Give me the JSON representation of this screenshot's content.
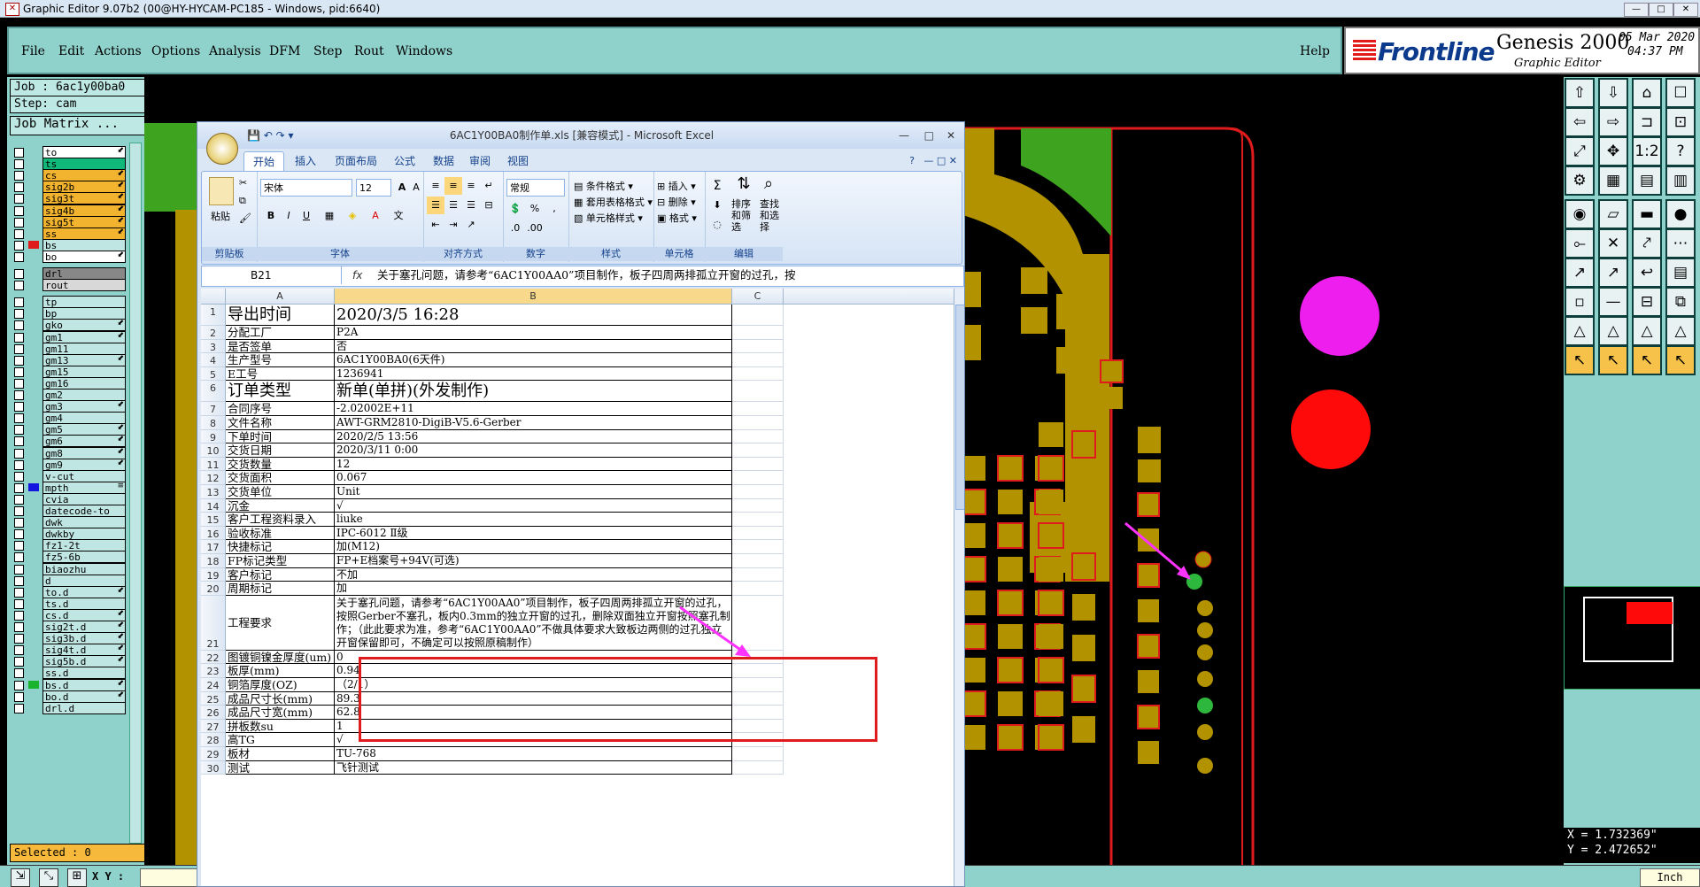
{
  "window": {
    "title": "Graphic Editor 9.07b2 (00@HY-HYCAM-PC185 - Windows, pid:6640)",
    "buttons": [
      "—",
      "□",
      "✕"
    ]
  },
  "menu": {
    "items": [
      "File",
      "Edit",
      "Actions",
      "Options",
      "Analysis",
      "DFM",
      "Step",
      "Rout",
      "Windows"
    ],
    "help": "Help"
  },
  "brand": {
    "frontline": "Frontline",
    "genesis": "Genesis 2000",
    "subtitle": "Graphic Editor",
    "date_line1": "05 Mar 2020",
    "date_line2": "04:37 PM"
  },
  "job": {
    "job": "Job : 6ac1y00ba0",
    "step": "Step: cam",
    "matrix": "Job Matrix ..."
  },
  "layers": [
    {
      "name": "to",
      "dir": "⬋",
      "color": ""
    },
    {
      "name": "ts",
      "dir": "",
      "color": "#10b87a"
    },
    {
      "name": "cs",
      "dir": "⬋",
      "color": "#f2b32e"
    },
    {
      "name": "sig2b",
      "dir": "⬋",
      "color": "#f2b32e"
    },
    {
      "name": "sig3t",
      "dir": "⬋",
      "color": "#f2b32e"
    },
    {
      "name": "sig4b",
      "dir": "⬋",
      "color": "#f2b32e"
    },
    {
      "name": "sig5t",
      "dir": "⬋",
      "color": "#f2b32e"
    },
    {
      "name": "ss",
      "dir": "⬋",
      "color": "#f2b32e"
    },
    {
      "name": "bs",
      "dir": "",
      "color": "#e01b1b"
    },
    {
      "name": "bo",
      "dir": "⬋",
      "color": ""
    },
    {
      "name": "drl",
      "dir": "",
      "color": "#888"
    },
    {
      "name": "rout",
      "dir": "",
      "color": "#d8d8d8"
    },
    {
      "name": "tp",
      "dir": "",
      "color": "#bfe6e2"
    },
    {
      "name": "bp",
      "dir": "",
      "color": "#bfe6e2"
    },
    {
      "name": "gko",
      "dir": "⬋",
      "color": "#bfe6e2"
    },
    {
      "name": "gm1",
      "dir": "⬋",
      "color": "#bfe6e2"
    },
    {
      "name": "gm11",
      "dir": "",
      "color": "#bfe6e2"
    },
    {
      "name": "gm13",
      "dir": "⬋",
      "color": "#bfe6e2"
    },
    {
      "name": "gm15",
      "dir": "",
      "color": "#bfe6e2"
    },
    {
      "name": "gm16",
      "dir": "",
      "color": "#bfe6e2"
    },
    {
      "name": "gm2",
      "dir": "",
      "color": "#bfe6e2"
    },
    {
      "name": "gm3",
      "dir": "⬋",
      "color": "#bfe6e2"
    },
    {
      "name": "gm4",
      "dir": "",
      "color": "#bfe6e2"
    },
    {
      "name": "gm5",
      "dir": "⬋",
      "color": "#bfe6e2"
    },
    {
      "name": "gm6",
      "dir": "⬋",
      "color": "#bfe6e2"
    },
    {
      "name": "gm8",
      "dir": "⬋",
      "color": "#bfe6e2"
    },
    {
      "name": "gm9",
      "dir": "⬋",
      "color": "#bfe6e2"
    },
    {
      "name": "v-cut",
      "dir": "",
      "color": "#bfe6e2"
    },
    {
      "name": "mpth",
      "dir": "≡",
      "color": "#1515e0"
    },
    {
      "name": "cvia",
      "dir": "",
      "color": "#bfe6e2"
    },
    {
      "name": "datecode-to",
      "dir": "",
      "color": "#bfe6e2"
    },
    {
      "name": "dwk",
      "dir": "",
      "color": "#bfe6e2"
    },
    {
      "name": "dwkby",
      "dir": "",
      "color": "#bfe6e2"
    },
    {
      "name": "fz1-2t",
      "dir": "",
      "color": "#bfe6e2"
    },
    {
      "name": "fz5-6b",
      "dir": "",
      "color": "#bfe6e2"
    },
    {
      "name": "biaozhu",
      "dir": "",
      "color": "#bfe6e2"
    },
    {
      "name": "d",
      "dir": "",
      "color": "#bfe6e2"
    },
    {
      "name": "to.d",
      "dir": "⬋",
      "color": "#bfe6e2"
    },
    {
      "name": "ts.d",
      "dir": "",
      "color": "#bfe6e2"
    },
    {
      "name": "cs.d",
      "dir": "⬋",
      "color": "#bfe6e2"
    },
    {
      "name": "sig2t.d",
      "dir": "⬋",
      "color": "#bfe6e2"
    },
    {
      "name": "sig3b.d",
      "dir": "⬋",
      "color": "#bfe6e2"
    },
    {
      "name": "sig4t.d",
      "dir": "⬋",
      "color": "#bfe6e2"
    },
    {
      "name": "sig5b.d",
      "dir": "⬋",
      "color": "#bfe6e2"
    },
    {
      "name": "ss.d",
      "dir": "",
      "color": "#bfe6e2"
    },
    {
      "name": "bs.d",
      "dir": "⬋",
      "color": "#19b32d"
    },
    {
      "name": "bo.d",
      "dir": "⬋",
      "color": "#bfe6e2"
    },
    {
      "name": "drl.d",
      "dir": "",
      "color": "#bfe6e2"
    }
  ],
  "selected": "Selected : 0",
  "coords": {
    "x": "X = 1.732369\"",
    "y": "Y = 2.472652\""
  },
  "xy_label": "X Y :",
  "unit": "Inch",
  "excel": {
    "title": "6AC1Y00BA0制作单.xls  [兼容模式] - Microsoft Excel",
    "tabs": [
      "开始",
      "插入",
      "页面布局",
      "公式",
      "数据",
      "审阅",
      "视图"
    ],
    "ribbon": {
      "paste": "粘贴",
      "clipboard": "剪贴板",
      "font_name": "宋体",
      "font_size": "12",
      "font": "字体",
      "align": "对齐方式",
      "number_format": "常规",
      "number": "数字",
      "cond_format": "条件格式",
      "table_format": "套用表格格式",
      "cell_style": "单元格样式",
      "styles": "样式",
      "insert": "插入",
      "delete": "删除",
      "format": "格式",
      "cells": "单元格",
      "sort_filter": "排序和筛选",
      "find_select": "查找和选择",
      "edit": "编辑"
    },
    "name_box": "B21",
    "fx": "fx",
    "formula": "关于塞孔问题，请参考“6AC1Y00AA0”项目制作，板子四周两排孤立开窗的过孔，按",
    "columns": [
      "A",
      "B",
      "C"
    ],
    "rows": [
      {
        "n": "1",
        "a": "导出时间",
        "b": "2020/3/5 16:28",
        "big": true
      },
      {
        "n": "2",
        "a": "分配工厂",
        "b": "P2A"
      },
      {
        "n": "3",
        "a": "是否签单",
        "b": "否"
      },
      {
        "n": "4",
        "a": "生产型号",
        "b": "6AC1Y00BA0(6天件)"
      },
      {
        "n": "5",
        "a": "E工号",
        "b": "1236941"
      },
      {
        "n": "6",
        "a": "订单类型",
        "b": "新单(单拼)(外发制作)",
        "big": true
      },
      {
        "n": "7",
        "a": "合同序号",
        "b": "-2.02002E+11"
      },
      {
        "n": "8",
        "a": "文件名称",
        "b": "AWT-GRM2810-DigiB-V5.6-Gerber"
      },
      {
        "n": "9",
        "a": "下单时间",
        "b": "2020/2/5 13:56"
      },
      {
        "n": "10",
        "a": "交货日期",
        "b": "2020/3/11 0:00"
      },
      {
        "n": "11",
        "a": "交货数量",
        "b": "12"
      },
      {
        "n": "12",
        "a": "交货面积",
        "b": "0.067"
      },
      {
        "n": "13",
        "a": "交货单位",
        "b": "Unit"
      },
      {
        "n": "14",
        "a": "沉金",
        "b": "√"
      },
      {
        "n": "15",
        "a": "客户工程资料录入",
        "b": "liuke"
      },
      {
        "n": "16",
        "a": "验收标准",
        "b": "IPC-6012 Ⅱ级"
      },
      {
        "n": "17",
        "a": "快捷标记",
        "b": "加(M12)"
      },
      {
        "n": "18",
        "a": "FP标记类型",
        "b": "FP+E档案号+94V(可选)"
      },
      {
        "n": "19",
        "a": "客户标记",
        "b": "不加"
      },
      {
        "n": "20",
        "a": "周期标记",
        "b": "加"
      },
      {
        "n": "21",
        "a": "工程要求",
        "b": "关于塞孔问题，请参考“6AC1Y00AA0”项目制作，板子四周两排孤立开窗的过孔，按照Gerber不塞孔，板内0.3mm的独立开窗的过孔，删除双面独立开窗按照塞孔制作；（此此要求为准，参考“6AC1Y00AA0”不做具体要求大致板边两侧的过孔独立开窗保留即可，不确定可以按照原稿制作）",
        "tall": true
      },
      {
        "n": "22",
        "a": "图镀铜镍金厚度(um)",
        "b": "0"
      },
      {
        "n": "23",
        "a": "板厚(mm)",
        "b": "0.94"
      },
      {
        "n": "24",
        "a": "铜箔厚度(OZ)",
        "b": "（2/1）"
      },
      {
        "n": "25",
        "a": "成品尺寸长(mm)",
        "b": "89.3"
      },
      {
        "n": "26",
        "a": "成品尺寸宽(mm)",
        "b": "62.8"
      },
      {
        "n": "27",
        "a": "拼板数su",
        "b": "1"
      },
      {
        "n": "28",
        "a": "高TG",
        "b": "√"
      },
      {
        "n": "29",
        "a": "板材",
        "b": "TU-768"
      },
      {
        "n": "30",
        "a": "测试",
        "b": "飞针测试"
      }
    ]
  },
  "colors": {
    "teal": "#8fd2cc",
    "pad": "#b39200",
    "outline": "#e01b1b",
    "green": "#3ea31f",
    "magenta": "#ee1fee",
    "arrow": "#ff33ff"
  }
}
